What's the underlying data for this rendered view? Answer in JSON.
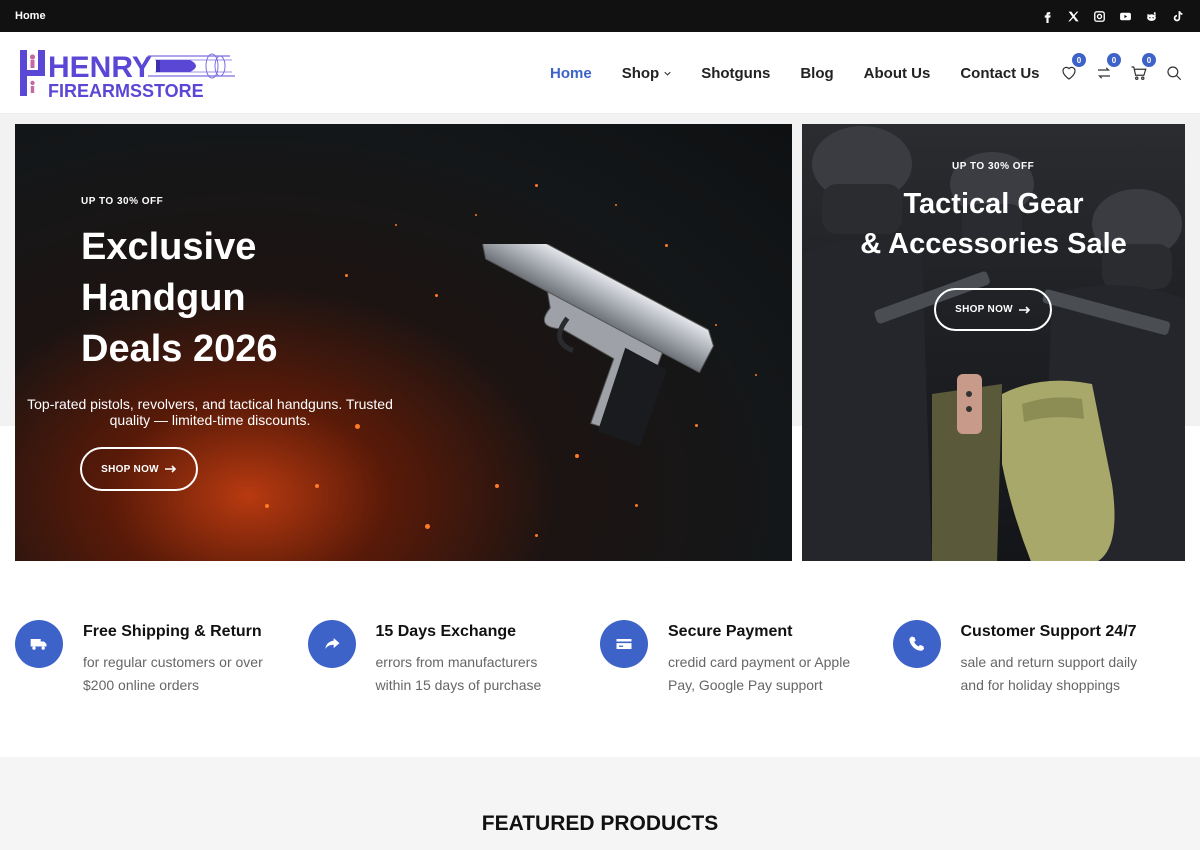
{
  "topbar": {
    "link": "Home"
  },
  "social": [
    "facebook-icon",
    "x-icon",
    "instagram-icon",
    "youtube-icon",
    "reddit-icon",
    "tiktok-icon"
  ],
  "logo": {
    "line1": "HENRY",
    "line2": "FIREARMSSTORE"
  },
  "nav": [
    {
      "label": "Home",
      "active": true
    },
    {
      "label": "Shop",
      "dropdown": true
    },
    {
      "label": "Shotguns"
    },
    {
      "label": "Blog"
    },
    {
      "label": "About Us"
    },
    {
      "label": "Contact Us"
    }
  ],
  "header_icons": {
    "wishlist_count": "0",
    "compare_count": "0",
    "cart_count": "0"
  },
  "banner_main": {
    "kicker": "UP TO 30% OFF",
    "title_line1": "Exclusive",
    "title_line2": "Handgun",
    "title_line3": "Deals 2026",
    "desc_line1": "Top-rated pistols, revolvers, and tactical handguns. Trusted",
    "desc_line2": "quality — limited-time discounts.",
    "button": "SHOP NOW"
  },
  "banner_side": {
    "kicker": "UP TO 30% OFF",
    "title_line1": "Tactical Gear",
    "title_line2": "& Accessories Sale",
    "button": "SHOP NOW"
  },
  "features": [
    {
      "icon": "truck-icon",
      "title": "Free Shipping & Return",
      "desc": "for regular customers or over $200 online orders"
    },
    {
      "icon": "share-arrow-icon",
      "title": "15 Days Exchange",
      "desc": "errors from manufacturers within 15 days of purchase"
    },
    {
      "icon": "credit-card-icon",
      "title": "Secure Payment",
      "desc": "credid card payment or Apple Pay, Google Pay support"
    },
    {
      "icon": "phone-icon",
      "title": "Customer Support 24/7",
      "desc": "sale and return support daily and for holiday shoppings"
    }
  ],
  "featured": {
    "title": "FEATURED PRODUCTS"
  },
  "colors": {
    "accent": "#3d63c9",
    "topbar": "#111111",
    "logo": "#5b47d6"
  }
}
